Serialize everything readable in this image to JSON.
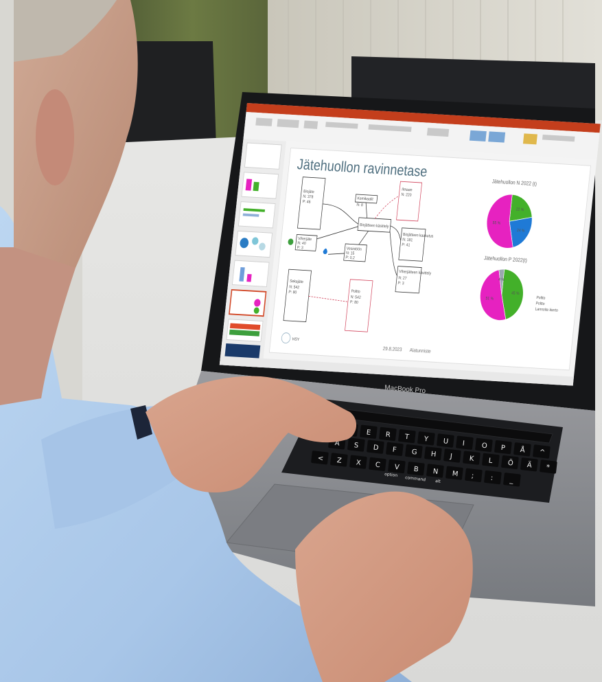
{
  "slide": {
    "title": "Jätehuollon ravinnetase",
    "date": "29.8.2023",
    "footer_text": "Alatunniste",
    "logo_text": "HSY"
  },
  "flow": {
    "box1": [
      "Biojäte",
      "N: 378",
      "P: 46"
    ],
    "box2": [
      "Kemikaalit",
      "N: 8"
    ],
    "box3": [
      "Ilmaan",
      "N: 220"
    ],
    "box4": [
      "Biojätteen käsittely"
    ],
    "box5": [
      "Viherjäte",
      "N: 40",
      "P: 3"
    ],
    "box6": [
      "Biojätteen kaasutus",
      "N: 181",
      "P: 41"
    ],
    "box7": [
      "Vesistöön",
      "N: 15",
      "P: 0,2"
    ],
    "box8": [
      "Viherjätteen käsittely",
      "N: 27",
      "P: 3"
    ],
    "box9": [
      "Sekajäte",
      "N: 542",
      "P: 80"
    ],
    "box10": [
      "Poltto",
      "N: 542",
      "P: 80"
    ]
  },
  "pie1": {
    "title": "Jätehuollon N 2022 (t)",
    "labels": [
      "22 %",
      "24 %",
      "55 %"
    ],
    "colors": [
      "#43b02a",
      "#1f7ad6",
      "#e622c0"
    ],
    "values": [
      22,
      24,
      55
    ]
  },
  "pie2": {
    "title": "Jätehuollon P 2022(t)",
    "labels": [
      "45 %",
      "51 %",
      "4 %"
    ],
    "colors": [
      "#43b02a",
      "#e622c0",
      "#9aa7b0"
    ],
    "values": [
      45,
      51,
      4
    ]
  },
  "pie2_legend": [
    "Poltto",
    "Poltto",
    "Lannoite kierto"
  ],
  "laptop": {
    "brand": "MacBook Pro"
  },
  "keys": {
    "row1": [
      "Q",
      "W",
      "E",
      "R",
      "T",
      "Y",
      "U",
      "I",
      "O",
      "P",
      "Å",
      "^"
    ],
    "row2": [
      "A",
      "S",
      "D",
      "F",
      "G",
      "H",
      "J",
      "K",
      "L",
      "Ö",
      "Ä",
      "*"
    ],
    "row3": [
      "<",
      "Z",
      "X",
      "C",
      "V",
      "B",
      "N",
      "M",
      ";",
      ":",
      "_"
    ],
    "cmd": "command",
    "alt": "alt",
    "option": "option"
  },
  "colors": {
    "ppt_red": "#d24726",
    "shirt_blue": "#a9c8ea",
    "laptop_gray": "#8a8c90",
    "pink": "#e622c0"
  }
}
